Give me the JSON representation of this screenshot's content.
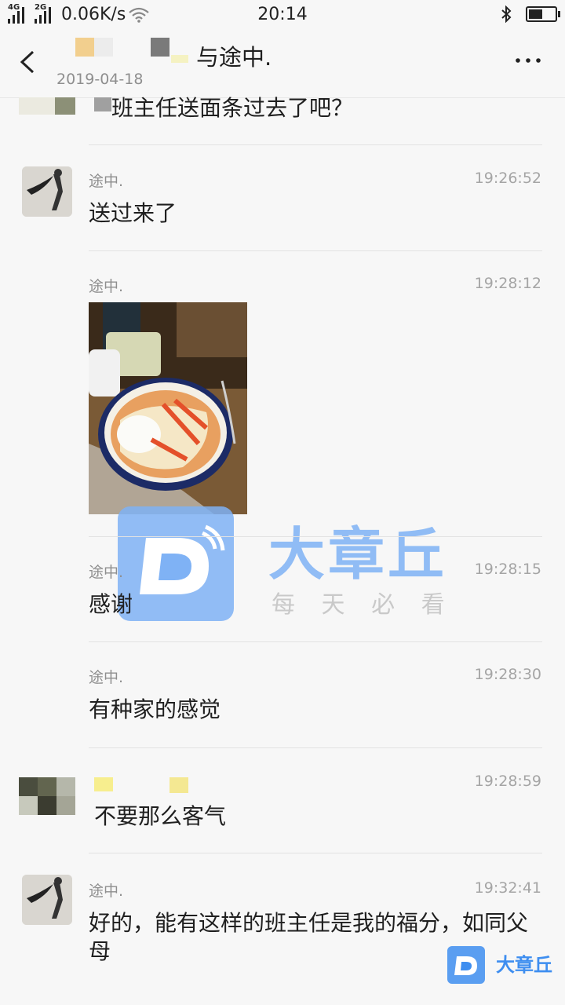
{
  "status_bar": {
    "net_4g": "4G",
    "net_2g": "2G",
    "speed": "0.06K/s",
    "time": "20:14",
    "bluetooth_icon": "bluetooth-icon",
    "battery_level": 0.62
  },
  "header": {
    "title": "与途中.",
    "date": "2019-04-18",
    "back_icon": "chevron-left-icon",
    "more_icon": "more-horizontal-icon"
  },
  "messages": [
    {
      "text": "班主任送面条过去了吧？"
    },
    {
      "sender": "途中.",
      "time": "19:26:52",
      "text": "送过来了"
    },
    {
      "sender": "途中.",
      "time": "19:28:12",
      "type": "image"
    },
    {
      "sender": "途中.",
      "time": "19:28:15",
      "text": "感谢"
    },
    {
      "sender": "途中.",
      "time": "19:28:30",
      "text": "有种家的感觉"
    },
    {
      "time": "19:28:59",
      "text": "不要那么客气"
    },
    {
      "sender": "途中.",
      "time": "19:32:41",
      "text": "好的，能有这样的班主任是我的福分，如同父母"
    }
  ],
  "watermark": {
    "brand": "大章丘",
    "slogan": "每 天 必 看",
    "small_brand": "大章丘"
  },
  "colors": {
    "brand_blue": "#3e8ef0",
    "watermark_blue": "#7fb2f5"
  }
}
